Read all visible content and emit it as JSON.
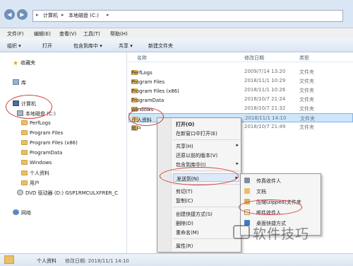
{
  "address": {
    "segments": [
      "计算机",
      "本地磁盘 (C:)"
    ],
    "separators": [
      "▸",
      "▸",
      "▸"
    ]
  },
  "menubar": [
    "文件(F)",
    "编辑(E)",
    "查看(V)",
    "工具(T)",
    "帮助(H)"
  ],
  "toolbar": {
    "organize": "组织 ▾",
    "open": "打开",
    "include_in_library": "包含到库中 ▾",
    "share": "共享 ▾",
    "new_folder": "新建文件夹"
  },
  "nav": {
    "favorites": "收藏夹",
    "libraries": "库",
    "computer": "计算机",
    "local_disk": "本地磁盘 (C:)",
    "folders": [
      "PerfLogs",
      "Program Files",
      "Program Files (x86)",
      "ProgramData",
      "Windows",
      "个人资料",
      "用户"
    ],
    "dvd": "DVD 驱动器 (D:) GSP1RMCULXFRER_C",
    "network": "网络"
  },
  "columns": {
    "name": "名称",
    "date": "修改日期",
    "type": "类型"
  },
  "files": [
    {
      "name": "PerfLogs",
      "date": "2009/7/14 13:20",
      "type": "文件夹"
    },
    {
      "name": "Program Files",
      "date": "2018/11/1 10:29",
      "type": "文件夹"
    },
    {
      "name": "Program Files (x86)",
      "date": "2018/11/1 10:26",
      "type": "文件夹"
    },
    {
      "name": "ProgramData",
      "date": "2018/10/7 21:24",
      "type": "文件夹"
    },
    {
      "name": "Windows",
      "date": "2018/10/7 21:32",
      "type": "文件夹"
    },
    {
      "name": "个人资料",
      "date": "2018/11/1 14:10",
      "type": "文件夹"
    },
    {
      "name": "用户",
      "date": "2018/10/7 21:49",
      "type": "文件夹"
    }
  ],
  "context_menu": {
    "open": "打开(O)",
    "open_new_window": "在新窗口中打开(E)",
    "share": "共享(H)",
    "restore": "还原以前的版本(V)",
    "include_library": "包含到库中(I)",
    "send_to": "发送到(N)",
    "cut": "剪切(T)",
    "copy": "复制(C)",
    "create_shortcut": "创建快捷方式(S)",
    "delete": "删除(D)",
    "rename": "重命名(M)",
    "properties": "属性(R)",
    "arrow": "▸"
  },
  "submenu": {
    "fax": "传真收件人",
    "docs": "文档",
    "zip": "压缩(zipped)文件夹",
    "mail": "邮件收件人",
    "desktop": "桌面快捷方式"
  },
  "status": {
    "name": "个人资料",
    "detail": "修改日期: 2018/11/1 14:10"
  },
  "watermark": "软件技巧",
  "colors": {
    "annotation": "#d43c3c",
    "selection": "#cde6fb",
    "folder": "#e8c066"
  }
}
